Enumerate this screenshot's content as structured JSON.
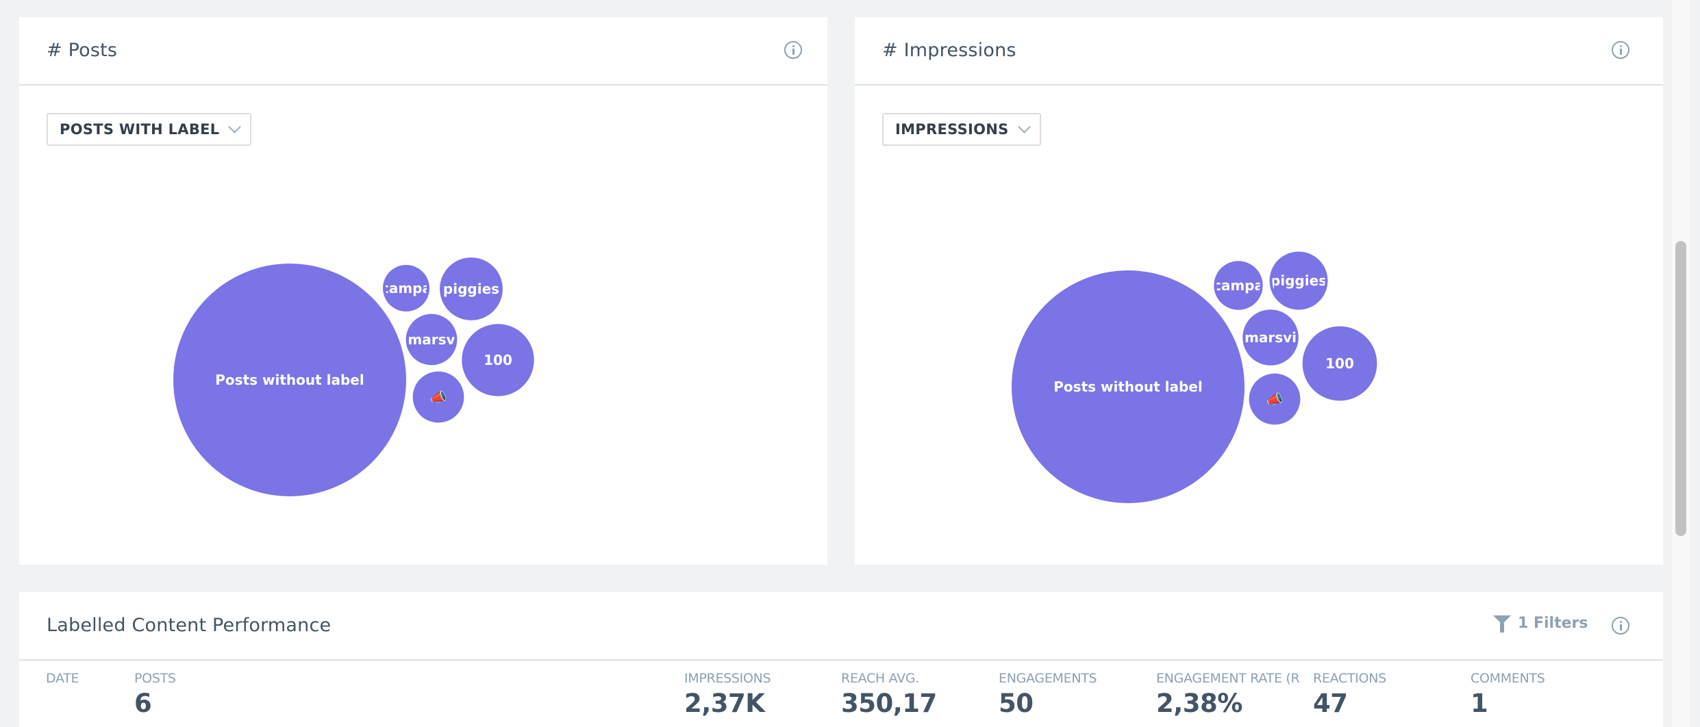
{
  "posts_card": {
    "title": "# Posts",
    "dropdown": {
      "selected": "POSTS WITH LABEL"
    },
    "info_icon": "info-icon"
  },
  "impressions_card": {
    "title": "# Impressions",
    "dropdown": {
      "selected": "IMPRESSIONS"
    },
    "info_icon": "info-icon"
  },
  "colors": {
    "bubble": "#7b74e6",
    "text_dark": "#435465",
    "text_muted": "#8ea1b1"
  },
  "chart_data": [
    {
      "type": "bubble",
      "title": "# Posts",
      "bubbles": [
        {
          "label": "Posts without label",
          "relative_size": 1.0
        },
        {
          "label": "campa",
          "relative_size": 0.2
        },
        {
          "label": "piggies",
          "relative_size": 0.27
        },
        {
          "label": "marsv",
          "relative_size": 0.22
        },
        {
          "label": "100",
          "relative_size": 0.31
        },
        {
          "label": "📣",
          "relative_size": 0.22
        }
      ]
    },
    {
      "type": "bubble",
      "title": "# Impressions",
      "bubbles": [
        {
          "label": "Posts without label",
          "relative_size": 1.0
        },
        {
          "label": "campa",
          "relative_size": 0.21
        },
        {
          "label": "piggies",
          "relative_size": 0.25
        },
        {
          "label": "marsvi",
          "relative_size": 0.24
        },
        {
          "label": "100",
          "relative_size": 0.32
        },
        {
          "label": "📣",
          "relative_size": 0.22
        }
      ]
    }
  ],
  "performance": {
    "title": "Labelled Content Performance",
    "filters_label": "1 Filters",
    "metrics": [
      {
        "label": "DATE",
        "value": ""
      },
      {
        "label": "POSTS",
        "value": "6"
      },
      {
        "label": "IMPRESSIONS",
        "value": "2,37K"
      },
      {
        "label": "REACH AVG.",
        "value": "350,17"
      },
      {
        "label": "ENGAGEMENTS",
        "value": "50"
      },
      {
        "label": "ENGAGEMENT RATE (R",
        "value": "2,38%"
      },
      {
        "label": "REACTIONS",
        "value": "47"
      },
      {
        "label": "COMMENTS",
        "value": "1"
      }
    ]
  }
}
